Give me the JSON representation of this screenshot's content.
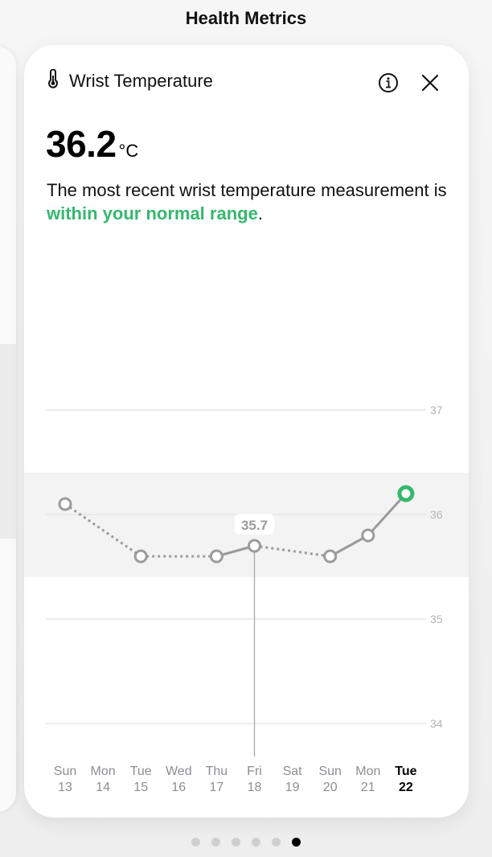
{
  "page": {
    "title": "Health Metrics"
  },
  "card": {
    "title": "Wrist Temperature",
    "icons": {
      "metric": "thermometer-icon",
      "info": "info-icon",
      "close": "close-icon"
    },
    "value": "36.2",
    "unit": "°C",
    "description_prefix": "The most recent wrist temperature measurement is ",
    "description_highlight": "within your normal range",
    "description_suffix": ".",
    "accent_color": "#35b86e"
  },
  "chart_data": {
    "type": "line",
    "title": "Wrist Temperature",
    "ylabel": "°C",
    "ylim": [
      33.7,
      37.15
    ],
    "yticks": [
      37,
      36,
      35,
      34
    ],
    "grid": true,
    "normal_range": [
      35.4,
      36.4
    ],
    "categories": [
      {
        "day": "Sun",
        "date": "13"
      },
      {
        "day": "Mon",
        "date": "14"
      },
      {
        "day": "Tue",
        "date": "15"
      },
      {
        "day": "Wed",
        "date": "16"
      },
      {
        "day": "Thu",
        "date": "17"
      },
      {
        "day": "Fri",
        "date": "18"
      },
      {
        "day": "Sat",
        "date": "19"
      },
      {
        "day": "Sun",
        "date": "20"
      },
      {
        "day": "Mon",
        "date": "21"
      },
      {
        "day": "Tue",
        "date": "22"
      }
    ],
    "values": [
      36.1,
      null,
      35.6,
      null,
      35.6,
      35.7,
      null,
      35.6,
      35.8,
      36.2
    ],
    "selected_index": 5,
    "selected_label": "35.7",
    "highlight_index": 9,
    "line_color": "#9b9b9d",
    "highlight_color": "#35b86e"
  },
  "pager": {
    "count": 6,
    "active_index": 5
  }
}
